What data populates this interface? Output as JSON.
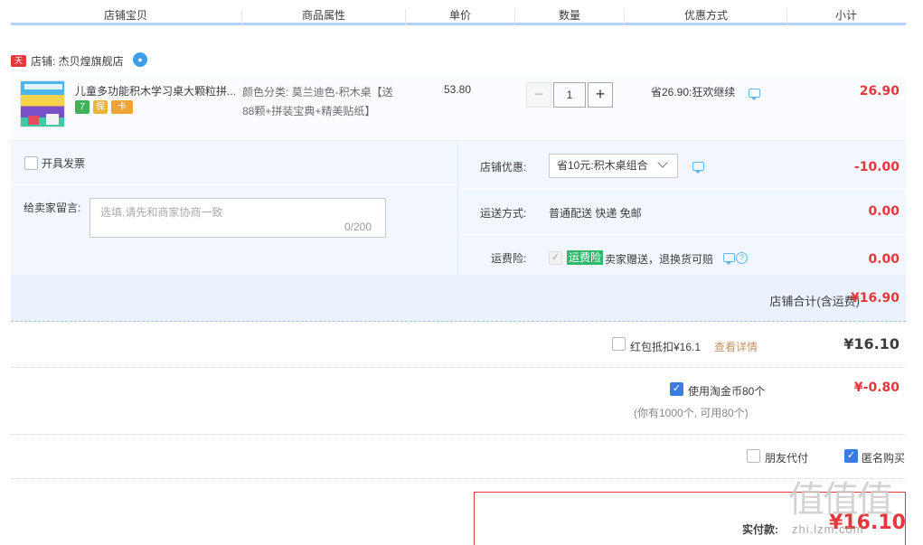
{
  "columns": [
    "店铺宝贝",
    "商品属性",
    "单价",
    "数量",
    "优惠方式",
    "小计"
  ],
  "store": {
    "badge": "天猫",
    "label": "店铺: 杰贝煌旗舰店",
    "wangwang_icon": "wangwang-chat-icon"
  },
  "item": {
    "title": "儿童多功能积木学习桌大颗粒拼...",
    "service_badges": [
      "7",
      "保",
      "卡"
    ],
    "sku_line1": "颜色分类: 莫兰迪色-积木桌【送",
    "sku_line2": "88颗+拼装宝典+精美贴纸】",
    "unit_price": "53.80",
    "quantity": "1",
    "minus": "−",
    "plus": "+",
    "promotion": "省26.90:狂欢继续",
    "subtotal": "26.90"
  },
  "options": {
    "invoice_label": "开具发票",
    "memo_label": "给卖家留言:",
    "memo_placeholder": "选填,请先和商家协商一致",
    "memo_count": "0/200",
    "shop_discount_label": "店铺优惠:",
    "shop_discount_value": "省10元:积木桌组合",
    "shop_discount_amount": "-10.00",
    "shipping_label": "运送方式:",
    "shipping_value": "普通配送 快递 免邮",
    "shipping_amount": "0.00",
    "insurance_label": "运费险:",
    "insurance_badge": "运费险",
    "insurance_text": "卖家赠送，退换货可赔",
    "insurance_amount": "0.00"
  },
  "store_total": {
    "label": "店铺合计(含运费)",
    "value": "¥16.90"
  },
  "redpacket": {
    "label": "红包抵扣¥16.1",
    "link": "查看详情",
    "amount": "¥16.10"
  },
  "coins": {
    "label": "使用淘金币80个",
    "note": "(你有1000个, 可用80个)",
    "amount": "¥-0.80"
  },
  "extras": {
    "friend_pay": "朋友代付",
    "anonymous": "匿名购买"
  },
  "payment": {
    "label": "实付款:",
    "value": "¥16.10"
  },
  "watermark": {
    "mark": "值值值",
    "site": "zhi.lzm.com"
  },
  "colors": {
    "accent_red": "#e4393c",
    "accent_blue": "#3b7be0",
    "panel_bg": "#f2f7ff"
  }
}
